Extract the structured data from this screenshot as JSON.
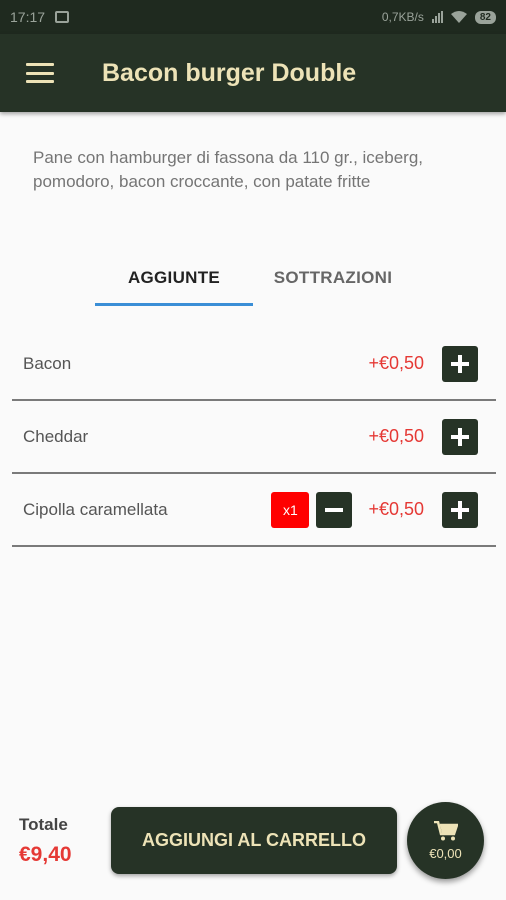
{
  "status_bar": {
    "time": "17:17",
    "network_speed": "0,7KB/s",
    "battery": "82"
  },
  "app_bar": {
    "title": "Bacon burger Double"
  },
  "description": "Pane con hamburger di fassona da 110 gr., iceberg, pomodoro, bacon croccante, con patate fritte",
  "tabs": [
    {
      "label": "AGGIUNTE",
      "active": true
    },
    {
      "label": "SOTTRAZIONI",
      "active": false
    }
  ],
  "items": [
    {
      "name": "Bacon",
      "price": "+€0,50"
    },
    {
      "name": "Cheddar",
      "price": "+€0,50"
    },
    {
      "name": "Cipolla caramellata",
      "price": "+€0,50",
      "quantity": "x1"
    }
  ],
  "footer": {
    "total_label": "Totale",
    "total_value": "€9,40",
    "add_to_cart_label": "AGGIUNGI AL CARRELLO",
    "cart_amount": "€0,00"
  },
  "colors": {
    "primary_dark": "#263326",
    "accent_text": "#ede3b7",
    "price_red": "#e53935",
    "tab_indicator": "#3a8ed6"
  },
  "icons": [
    "menu-icon",
    "plus-icon",
    "minus-icon",
    "cart-icon"
  ]
}
